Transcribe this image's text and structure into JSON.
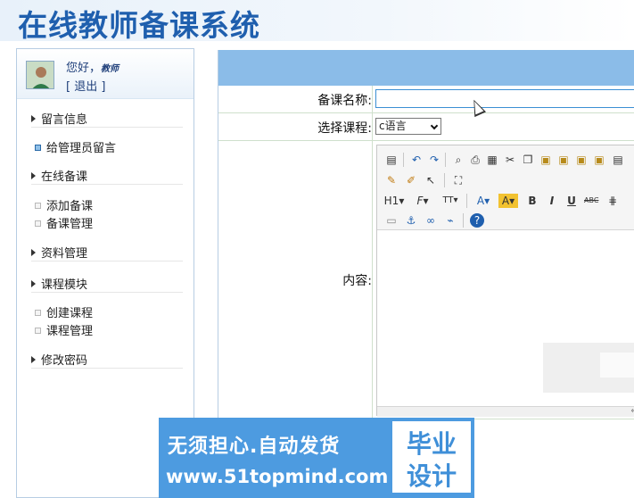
{
  "header": {
    "title": "在线教师备课系统"
  },
  "user": {
    "greeting": "您好，",
    "role": "教师",
    "logout": "[ 退出 ]"
  },
  "menu": {
    "groups": [
      {
        "label": "留言信息",
        "items": [
          "给管理员留言"
        ]
      },
      {
        "label": "在线备课",
        "items": [
          "添加备课",
          "备课管理"
        ]
      },
      {
        "label": "资料管理",
        "items": []
      },
      {
        "label": "课程模块",
        "items": [
          "创建课程",
          "课程管理"
        ]
      },
      {
        "label": "修改密码",
        "items": []
      }
    ]
  },
  "form": {
    "name_label": "备课名称:",
    "name_value": "",
    "course_label": "选择课程:",
    "course_selected": "c语言",
    "content_label": "内容:"
  },
  "editor": {
    "toolbar_labels": {
      "heading": "H1",
      "font": "F",
      "size": "TT",
      "bold": "B",
      "italic": "I",
      "underline": "U"
    }
  },
  "banner": {
    "line1": "无须担心.自动发货",
    "line2": "www.51topmind.com",
    "seal_top": "毕业",
    "seal_bottom": "设计"
  }
}
